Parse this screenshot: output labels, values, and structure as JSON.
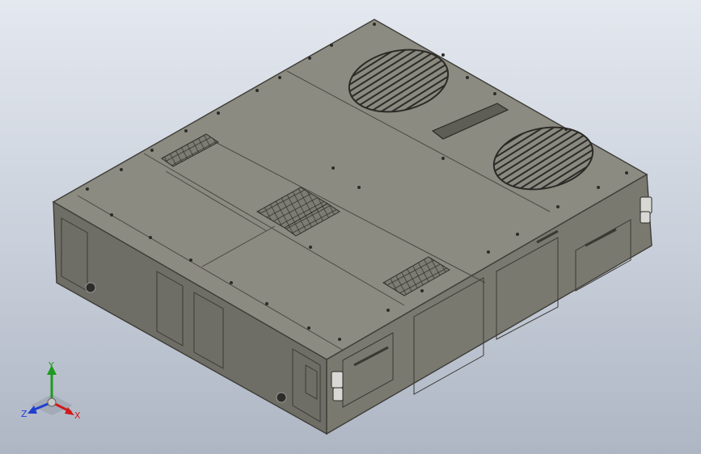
{
  "viewport": {
    "background_top": "#e4e8ef",
    "background_bottom": "#aeb6c4"
  },
  "model": {
    "body_color": "#84837a",
    "edge_color": "#3e3d38",
    "top_panel_color": "#8c8b81",
    "front_panel_color": "#6f6e66",
    "side_panel_color": "#7a7970",
    "fan_count": 2,
    "vent_grille_count": 4
  },
  "triad": {
    "x_label": "X",
    "y_label": "Y",
    "z_label": "Z",
    "x_color": "#d11a1a",
    "y_color": "#1f9a1f",
    "z_color": "#1f3fd1",
    "x_icon": "axis-x-arrow-icon",
    "y_icon": "axis-y-arrow-icon",
    "z_icon": "axis-z-arrow-icon"
  }
}
